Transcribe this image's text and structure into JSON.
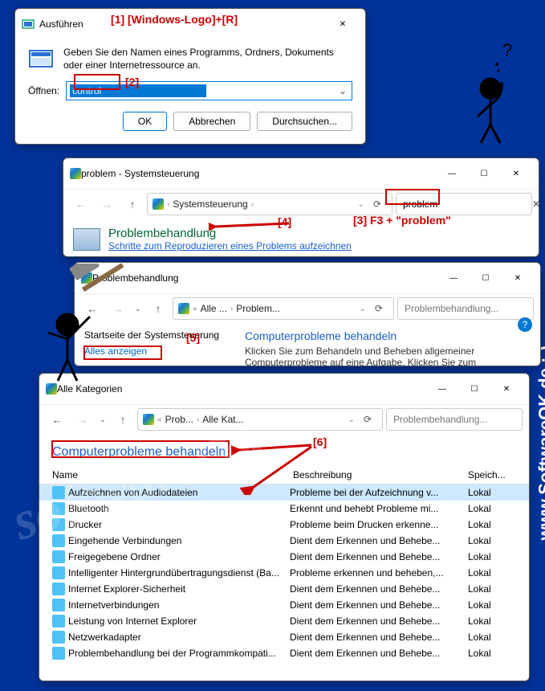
{
  "run": {
    "title": "Ausführen",
    "message": "Geben Sie den Namen eines Programms, Ordners, Dokuments oder einer Internetressource an.",
    "open_label": "Öffnen:",
    "open_value": "control",
    "ok": "OK",
    "cancel": "Abbrechen",
    "browse": "Durchsuchen..."
  },
  "annotations": {
    "a1": "[1]  [Windows-Logo]+[R]",
    "a2": "[2]",
    "a3": "[3] F3 + \"problem\"",
    "a4": "[4]",
    "a5": "[5]",
    "a6": "[6]"
  },
  "win2": {
    "title": "problem - Systemsteuerung",
    "crumb1": "Systemsteuerung",
    "search_value": "problem",
    "result_title": "Problembehandlung",
    "result_sub": "Schritte zum Reproduzieren eines Problems aufzeichnen"
  },
  "win3": {
    "title": "Problembehandlung",
    "crumb1": "Alle ...",
    "crumb2": "Problem...",
    "search_placeholder": "Problembehandlung...",
    "home": "Startseite der Systemsteuerung",
    "view_all": "Alles anzeigen",
    "right_head": "Computerprobleme behandeln",
    "right_body": "Klicken Sie zum Behandeln und Beheben allgemeiner Computerprobleme auf eine Aufgabe. Klicken Sie zum"
  },
  "win4": {
    "title": "Alle Kategorien",
    "crumb1": "Prob...",
    "crumb2": "Alle Kat...",
    "search_placeholder": "Problembehandlung...",
    "head": "Computerprobleme behandeln",
    "col_name": "Name",
    "col_desc": "Beschreibung",
    "col_loc": "Speich...",
    "rows": [
      {
        "name": "Aufzeichnen von Audiodateien",
        "desc": "Probleme bei der Aufzeichnung v...",
        "loc": "Lokal"
      },
      {
        "name": "Bluetooth",
        "desc": "Erkennt und behebt Probleme mi...",
        "loc": "Lokal"
      },
      {
        "name": "Drucker",
        "desc": "Probleme beim Drucken erkenne...",
        "loc": "Lokal"
      },
      {
        "name": "Eingehende Verbindungen",
        "desc": "Dient dem Erkennen und Behebe...",
        "loc": "Lokal"
      },
      {
        "name": "Freigegebene Ordner",
        "desc": "Dient dem Erkennen und Behebe...",
        "loc": "Lokal"
      },
      {
        "name": "Intelligenter Hintergrundübertragungsdienst (Ba...",
        "desc": "Probleme erkennen und beheben,...",
        "loc": "Lokal"
      },
      {
        "name": "Internet Explorer-Sicherheit",
        "desc": "Dient dem Erkennen und Behebe...",
        "loc": "Lokal"
      },
      {
        "name": "Internetverbindungen",
        "desc": "Dient dem Erkennen und Behebe...",
        "loc": "Lokal"
      },
      {
        "name": "Leistung von Internet Explorer",
        "desc": "Dient dem Erkennen und Behebe...",
        "loc": "Lokal"
      },
      {
        "name": "Netzwerkadapter",
        "desc": "Dient dem Erkennen und Behebe...",
        "loc": "Lokal"
      },
      {
        "name": "Problembehandlung bei der Programmkompati...",
        "desc": "Dient dem Erkennen und Behebe...",
        "loc": "Lokal"
      }
    ]
  },
  "side": "www.SoftwareOK.de :-)",
  "watermark": "softwareOK"
}
